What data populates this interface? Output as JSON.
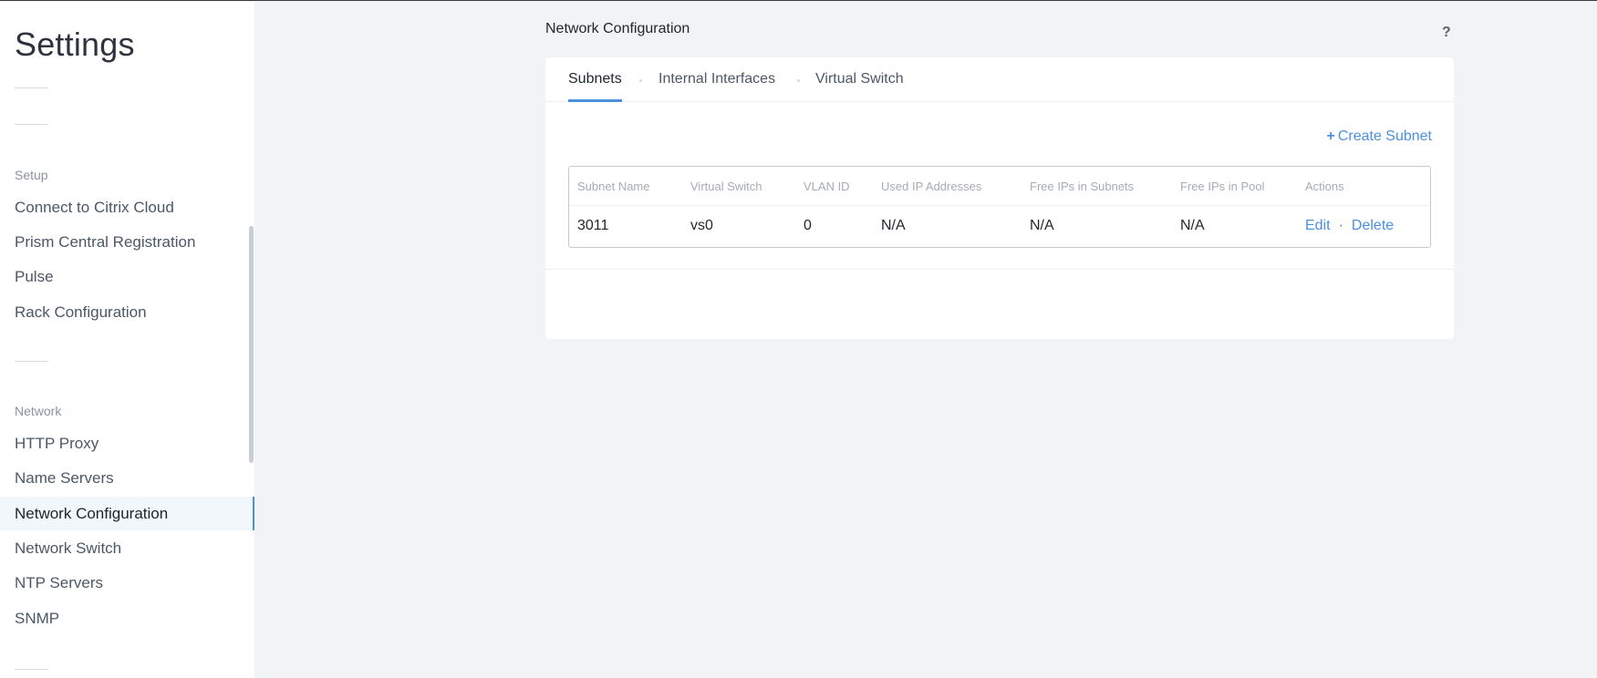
{
  "sidebar": {
    "title": "Settings",
    "sections": [
      {
        "label": "Setup",
        "items": [
          "Connect to Citrix Cloud",
          "Prism Central Registration",
          "Pulse",
          "Rack Configuration"
        ]
      },
      {
        "label": "Network",
        "items": [
          "HTTP Proxy",
          "Name Servers",
          "Network Configuration",
          "Network Switch",
          "NTP Servers",
          "SNMP"
        ]
      }
    ],
    "active_item": "Network Configuration"
  },
  "main": {
    "title": "Network Configuration",
    "help_icon": "?",
    "tabs": [
      "Subnets",
      "Internal Interfaces",
      "Virtual Switch"
    ],
    "active_tab": "Subnets",
    "create_link": {
      "plus": "+",
      "label": "Create Subnet"
    },
    "table": {
      "headers": [
        "Subnet Name",
        "Virtual Switch",
        "VLAN ID",
        "Used IP Addresses",
        "Free IPs in Subnets",
        "Free IPs in Pool",
        "Actions"
      ],
      "rows": [
        {
          "subnet_name": "3011",
          "virtual_switch": "vs0",
          "vlan_id": "0",
          "used_ip_addresses": "N/A",
          "free_ips_in_subnets": "N/A",
          "free_ips_in_pool": "N/A",
          "actions": {
            "edit": "Edit",
            "separator": "·",
            "delete": "Delete"
          }
        }
      ]
    }
  },
  "colors": {
    "accent": "#4a8fe0",
    "page_background": "#f2f3f5",
    "panel_background": "#ffffff",
    "active_nav_background": "#f2f7fc"
  }
}
